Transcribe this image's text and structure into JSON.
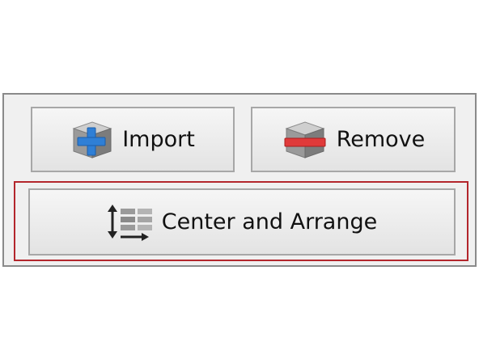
{
  "toolbar": {
    "import": {
      "label": "Import",
      "icon": "cube-add-icon",
      "accent": "#2f7fd6"
    },
    "remove": {
      "label": "Remove",
      "icon": "cube-remove-icon",
      "accent": "#e03a3a"
    },
    "center_arrange": {
      "label": "Center and Arrange",
      "icon": "arrange-icon",
      "highlight_color": "#b3262c"
    }
  }
}
